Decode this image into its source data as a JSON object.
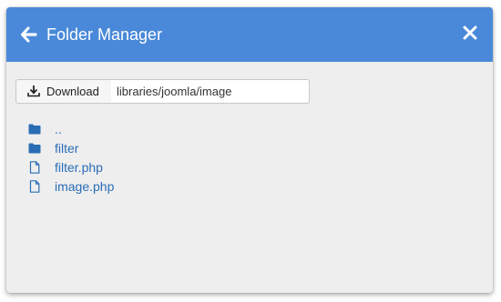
{
  "modal": {
    "title": "Folder Manager",
    "header_color": "#4a89d9",
    "back_icon": "arrow-left-icon",
    "close_icon": "close-icon"
  },
  "toolbar": {
    "download_label": "Download",
    "download_icon": "download-icon",
    "path_value": "libraries/joomla/image"
  },
  "files": [
    {
      "name": "..",
      "type": "folder",
      "icon": "folder-icon"
    },
    {
      "name": "filter",
      "type": "folder",
      "icon": "folder-icon"
    },
    {
      "name": "filter.php",
      "type": "file",
      "icon": "file-icon"
    },
    {
      "name": "image.php",
      "type": "file",
      "icon": "file-icon"
    }
  ],
  "colors": {
    "link": "#2a6db5",
    "background": "#eeeeee"
  }
}
